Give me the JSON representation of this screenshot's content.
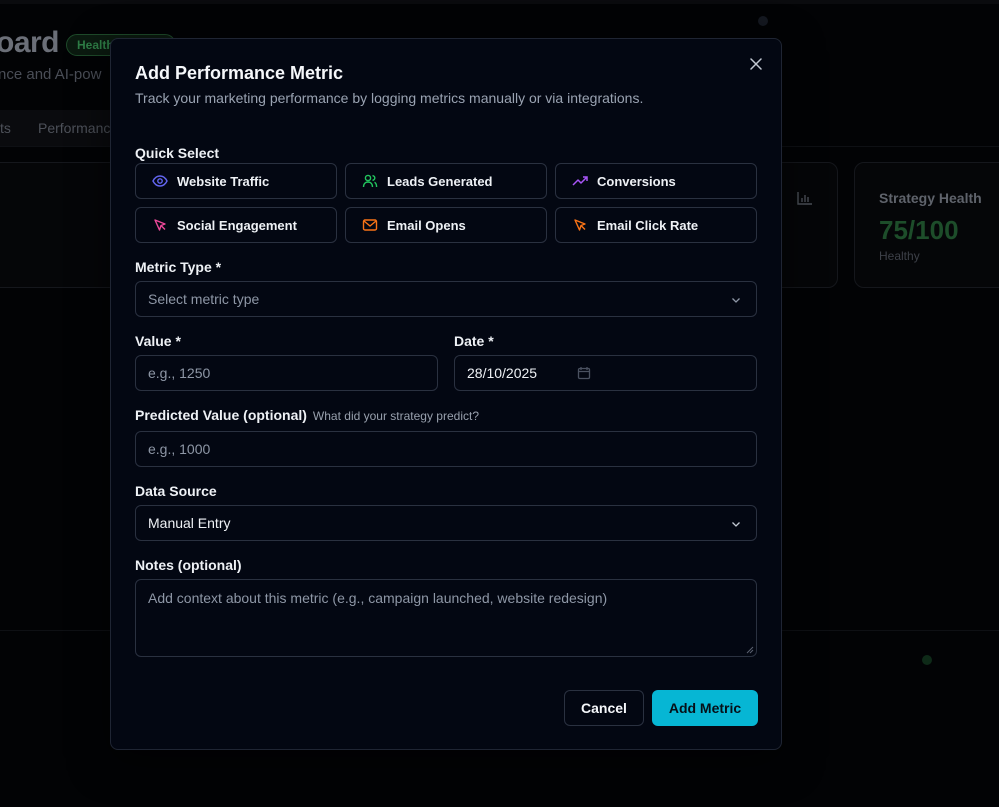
{
  "background": {
    "title": "oard",
    "badge": "Health",
    "subtitle": "nce and AI-pow",
    "tabs": [
      "ts",
      "Performanc"
    ],
    "cards": [
      {
        "title": "Strategy Health",
        "value": "75/100",
        "sub": "Healthy"
      }
    ]
  },
  "modal": {
    "title": "Add Performance Metric",
    "description": "Track your marketing performance by logging metrics manually or via integrations.",
    "close_icon": "x-icon",
    "quick_select": {
      "label": "Quick Select",
      "options": [
        {
          "label": "Website Traffic",
          "icon": "eye-icon",
          "color": "#6366f1"
        },
        {
          "label": "Leads Generated",
          "icon": "users-icon",
          "color": "#22c55e"
        },
        {
          "label": "Conversions",
          "icon": "trending-up-icon",
          "color": "#a855f7"
        },
        {
          "label": "Social Engagement",
          "icon": "cursor-click-icon",
          "color": "#ec4899"
        },
        {
          "label": "Email Opens",
          "icon": "mail-icon",
          "color": "#f97316"
        },
        {
          "label": "Email Click Rate",
          "icon": "cursor-click-icon",
          "color": "#f97316"
        }
      ]
    },
    "metric_type": {
      "label": "Metric Type *",
      "placeholder": "Select metric type"
    },
    "value": {
      "label": "Value *",
      "placeholder": "e.g., 1250"
    },
    "date": {
      "label": "Date *",
      "value": "28/10/2025"
    },
    "predicted": {
      "label": "Predicted Value (optional)",
      "hint": "What did your strategy predict?",
      "placeholder": "e.g., 1000"
    },
    "data_source": {
      "label": "Data Source",
      "value": "Manual Entry"
    },
    "notes": {
      "label": "Notes (optional)",
      "placeholder": "Add context about this metric (e.g., campaign launched, website redesign)"
    },
    "buttons": {
      "cancel": "Cancel",
      "submit": "Add Metric"
    },
    "accent_color": "#06b6d4"
  }
}
